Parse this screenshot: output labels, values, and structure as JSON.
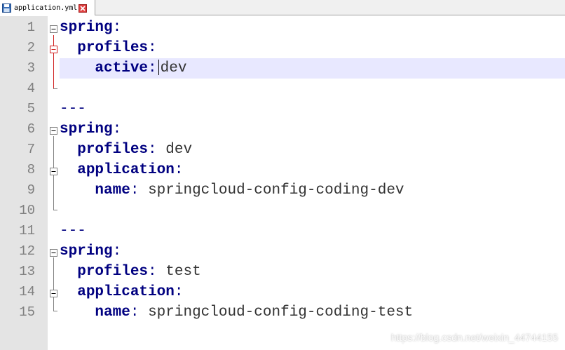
{
  "tab": {
    "title": "application.yml",
    "save_icon": "save-disk-icon",
    "close_icon": "close-icon"
  },
  "colors": {
    "key": "#000080",
    "value": "#333333",
    "line_number": "#808080",
    "gutter": "#e4e4e4",
    "current_line": "#e8e8ff"
  },
  "lines": [
    {
      "num": "1",
      "key": "spring",
      "sep": ":",
      "val": ""
    },
    {
      "num": "2",
      "key": "profiles",
      "sep": ":",
      "val": ""
    },
    {
      "num": "3",
      "key": "active",
      "sep": ":",
      "val": "dev"
    },
    {
      "num": "4",
      "text": ""
    },
    {
      "num": "5",
      "text": "---"
    },
    {
      "num": "6",
      "key": "spring",
      "sep": ":",
      "val": ""
    },
    {
      "num": "7",
      "key": "profiles",
      "sep": ":",
      "val": "dev"
    },
    {
      "num": "8",
      "key": "application",
      "sep": ":",
      "val": ""
    },
    {
      "num": "9",
      "key": "name",
      "sep": ":",
      "val": "springcloud-config-coding-dev"
    },
    {
      "num": "10",
      "text": ""
    },
    {
      "num": "11",
      "text": "---"
    },
    {
      "num": "12",
      "key": "spring",
      "sep": ":",
      "val": ""
    },
    {
      "num": "13",
      "key": "profiles",
      "sep": ":",
      "val": "test"
    },
    {
      "num": "14",
      "key": "application",
      "sep": ":",
      "val": ""
    },
    {
      "num": "15",
      "key": "name",
      "sep": ":",
      "val": "springcloud-config-coding-test"
    }
  ],
  "watermark": "https://blog.csdn.net/weixin_44744155"
}
